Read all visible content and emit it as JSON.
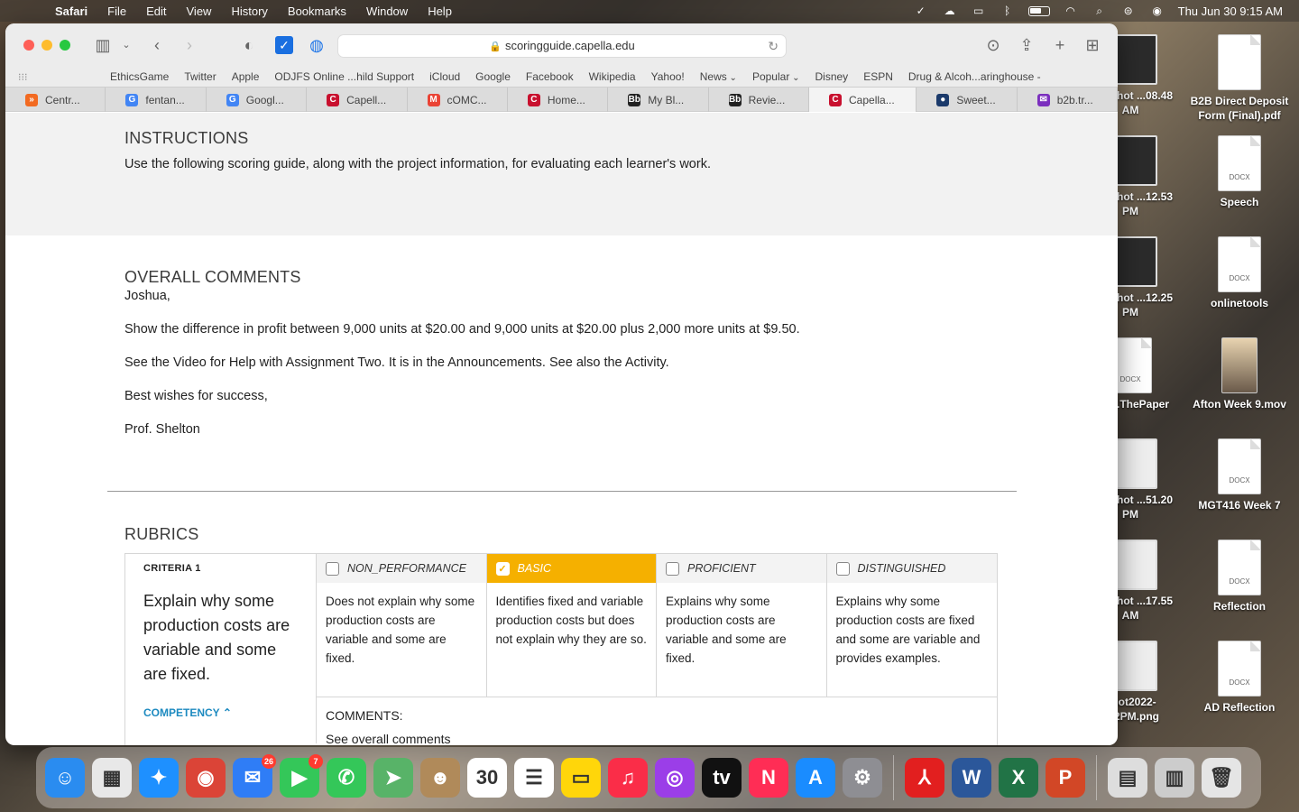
{
  "menubar": {
    "app": "Safari",
    "items": [
      "File",
      "Edit",
      "View",
      "History",
      "Bookmarks",
      "Window",
      "Help"
    ],
    "clock": "Thu Jun 30  9:15 AM"
  },
  "browser": {
    "url": "scoringguide.capella.edu",
    "favorites": [
      "EthicsGame",
      "Twitter",
      "Apple",
      "ODJFS Online ...hild Support",
      "iCloud",
      "Google",
      "Facebook",
      "Wikipedia",
      "Yahoo!",
      "News",
      "Popular",
      "Disney",
      "ESPN",
      "Drug & Alcoh...aringhouse -"
    ],
    "tabs": [
      {
        "label": "Centr...",
        "icon": "»",
        "color": "#f26a21"
      },
      {
        "label": "fentan...",
        "icon": "G",
        "color": "#4285f4"
      },
      {
        "label": "Googl...",
        "icon": "G",
        "color": "#4285f4"
      },
      {
        "label": "Capell...",
        "icon": "C",
        "color": "#c8102e"
      },
      {
        "label": "cOMC...",
        "icon": "M",
        "color": "#ea4335"
      },
      {
        "label": "Home...",
        "icon": "C",
        "color": "#c8102e"
      },
      {
        "label": "My Bl...",
        "icon": "Bb",
        "color": "#222"
      },
      {
        "label": "Revie...",
        "icon": "Bb",
        "color": "#222"
      },
      {
        "label": "Capella...",
        "icon": "C",
        "color": "#c8102e"
      },
      {
        "label": "Sweet...",
        "icon": "●",
        "color": "#1b3a6b"
      },
      {
        "label": "b2b.tr...",
        "icon": "✉",
        "color": "#7b2fbe"
      }
    ]
  },
  "page": {
    "instructions": {
      "title": "INSTRUCTIONS",
      "text": "Use the following scoring guide, along with the project information, for evaluating each learner's work."
    },
    "overall": {
      "title": "OVERALL COMMENTS",
      "greeting": "Joshua,",
      "p1": "Show the difference in profit between 9,000 units at $20.00 and 9,000 units at $20.00 plus 2,000 more units at $9.50.",
      "p2": "See the Video for Help with Assignment Two. It is in the Announcements. See also the Activity.",
      "p3": "Best wishes for success,",
      "p4": "Prof. Shelton"
    },
    "rubrics": {
      "title": "RUBRICS",
      "criteria_label": "CRITERIA 1",
      "criteria_text": "Explain why some production costs are variable and some are fixed.",
      "competency": "COMPETENCY",
      "levels": [
        {
          "name": "NON_PERFORMANCE",
          "desc": "Does not explain why some production costs are variable and some are fixed.",
          "selected": false
        },
        {
          "name": "BASIC",
          "desc": "Identifies fixed and variable production costs but does not explain why they are so.",
          "selected": true
        },
        {
          "name": "PROFICIENT",
          "desc": "Explains why some production costs are variable and some are fixed.",
          "selected": false
        },
        {
          "name": "DISTINGUISHED",
          "desc": "Explains why some production costs are fixed and some are variable and provides examples.",
          "selected": false
        }
      ],
      "comments_label": "COMMENTS:",
      "comments_text": "See overall comments"
    }
  },
  "desktop": {
    "items": [
      {
        "label": "een Shot ...08.48 AM",
        "kind": "img"
      },
      {
        "label": "B2B Direct Deposit Form (Final).pdf",
        "kind": "doc"
      },
      {
        "label": "een Shot ...12.53 PM",
        "kind": "img"
      },
      {
        "label": "Speech",
        "kind": "docx"
      },
      {
        "label": "een Shot ...12.25 PM",
        "kind": "img"
      },
      {
        "label": "onlinetools",
        "kind": "docx"
      },
      {
        "label": "SM ...ThePaper",
        "kind": "docx"
      },
      {
        "label": "Afton Week 9.mov",
        "kind": "photo"
      },
      {
        "label": "een Shot ...51.20 PM",
        "kind": "img"
      },
      {
        "label": "MGT416 Week 7",
        "kind": "docx"
      },
      {
        "label": "een Shot ...17.55 AM",
        "kind": "img"
      },
      {
        "label": "Reflection",
        "kind": "docx"
      },
      {
        "label": "Shot2022- t...2PM.png",
        "kind": "img"
      },
      {
        "label": "AD Reflection",
        "kind": "docx"
      }
    ],
    "docx_tag": "DOCX"
  },
  "dock": {
    "apps": [
      {
        "name": "finder-icon",
        "glyph": "☺",
        "color": "#2a8cf0"
      },
      {
        "name": "launchpad-icon",
        "glyph": "▦",
        "color": "#e8e8e8"
      },
      {
        "name": "safari-icon",
        "glyph": "✦",
        "color": "#1e90ff"
      },
      {
        "name": "chrome-icon",
        "glyph": "◉",
        "color": "#db4437"
      },
      {
        "name": "mail-icon",
        "glyph": "✉",
        "color": "#2f7df6",
        "badge": "26"
      },
      {
        "name": "facetime-icon",
        "glyph": "▶",
        "color": "#34c759",
        "badge": "7"
      },
      {
        "name": "messages-icon",
        "glyph": "✆",
        "color": "#34c759"
      },
      {
        "name": "maps-icon",
        "glyph": "➤",
        "color": "#58b368"
      },
      {
        "name": "contacts-icon",
        "glyph": "☻",
        "color": "#b08a5a"
      },
      {
        "name": "calendar-icon",
        "glyph": "30",
        "color": "#ffffff"
      },
      {
        "name": "reminders-icon",
        "glyph": "☰",
        "color": "#ffffff"
      },
      {
        "name": "notes-icon",
        "glyph": "▭",
        "color": "#ffd60a"
      },
      {
        "name": "music-icon",
        "glyph": "♫",
        "color": "#fa2d48"
      },
      {
        "name": "podcasts-icon",
        "glyph": "◎",
        "color": "#9b3ee8"
      },
      {
        "name": "tv-icon",
        "glyph": "tv",
        "color": "#111111"
      },
      {
        "name": "news-icon",
        "glyph": "N",
        "color": "#ff2d55"
      },
      {
        "name": "app-store-icon",
        "glyph": "A",
        "color": "#1a8cff"
      },
      {
        "name": "system-preferences-icon",
        "glyph": "⚙",
        "color": "#8e8e93"
      },
      {
        "name": "acrobat-icon",
        "glyph": "⅄",
        "color": "#e21f1f"
      },
      {
        "name": "word-icon",
        "glyph": "W",
        "color": "#2b579a"
      },
      {
        "name": "excel-icon",
        "glyph": "X",
        "color": "#217346"
      },
      {
        "name": "powerpoint-icon",
        "glyph": "P",
        "color": "#d24726"
      }
    ],
    "others": [
      {
        "name": "recent-document-icon",
        "glyph": "▤",
        "color": "#dddddd"
      },
      {
        "name": "downloads-stack-icon",
        "glyph": "▥",
        "color": "#cccccc"
      },
      {
        "name": "trash-icon",
        "glyph": "🗑",
        "color": "#e5e5e5"
      }
    ]
  }
}
